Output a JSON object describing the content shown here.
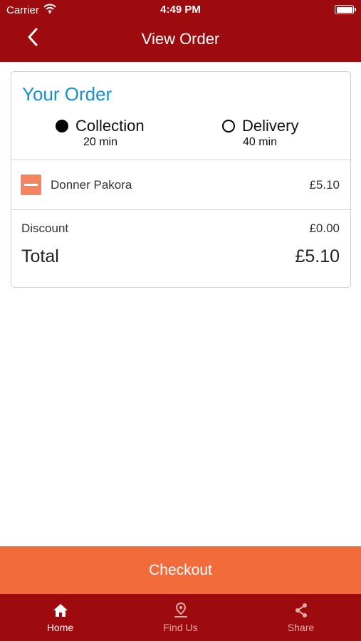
{
  "status_bar": {
    "carrier": "Carrier",
    "time": "4:49 PM"
  },
  "nav": {
    "title": "View Order",
    "back_icon": "chevron-left-icon"
  },
  "order": {
    "heading": "Your Order",
    "options": [
      {
        "label": "Collection",
        "time": "20 min",
        "selected": true
      },
      {
        "label": "Delivery",
        "time": "40 min",
        "selected": false
      }
    ],
    "items": [
      {
        "name": "Donner Pakora",
        "price": "£5.10"
      }
    ],
    "discount_label": "Discount",
    "discount_value": "£0.00",
    "total_label": "Total",
    "total_value": "£5.10"
  },
  "checkout_label": "Checkout",
  "tabs": [
    {
      "label": "Home",
      "icon": "home-icon",
      "active": true
    },
    {
      "label": "Find Us",
      "icon": "location-pin-icon",
      "active": false
    },
    {
      "label": "Share",
      "icon": "share-icon",
      "active": false
    }
  ],
  "colors": {
    "brand_red": "#9e0b0f",
    "accent_orange": "#f26b3a",
    "minus_orange": "#f4845f",
    "heading_blue": "#1a8fd0",
    "tab_inactive": "#e4a9a9"
  }
}
